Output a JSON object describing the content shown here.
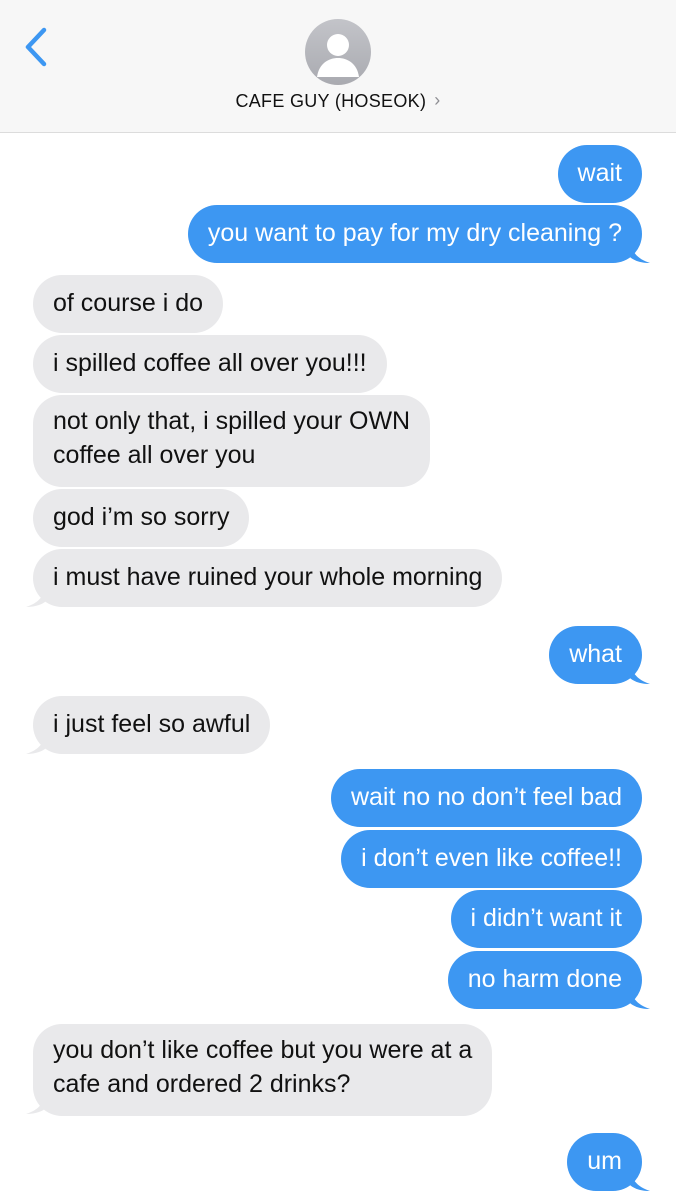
{
  "header": {
    "contact_name": "CAFE GUY (HOSEOK)",
    "chevron": "›",
    "back_icon": "chevron-left-icon",
    "avatar_icon": "person-silhouette-icon",
    "accent_color": "#3d97f2"
  },
  "messages": [
    {
      "from": "me",
      "text": "wait"
    },
    {
      "from": "me",
      "text": "you want to pay for my dry cleaning ?"
    },
    {
      "from": "them",
      "text": "of course i do"
    },
    {
      "from": "them",
      "text": "i spilled coffee all over you!!!"
    },
    {
      "from": "them",
      "text": "not only that, i spilled your OWN\ncoffee all over you"
    },
    {
      "from": "them",
      "text": "god i’m so sorry"
    },
    {
      "from": "them",
      "text": "i must have ruined your whole morning"
    },
    {
      "from": "me",
      "text": "what"
    },
    {
      "from": "them",
      "text": "i just feel so awful"
    },
    {
      "from": "me",
      "text": "wait no no don’t feel bad"
    },
    {
      "from": "me",
      "text": "i don’t even like coffee!!"
    },
    {
      "from": "me",
      "text": "i didn’t want it"
    },
    {
      "from": "me",
      "text": "no harm done"
    },
    {
      "from": "them",
      "text": "you don’t like coffee but you were at a\ncafe and ordered 2 drinks?"
    },
    {
      "from": "me",
      "text": "um"
    }
  ],
  "colors": {
    "sent_bubble": "#3d97f2",
    "received_bubble": "#e9e9eb",
    "header_bg": "#f7f7f7"
  }
}
